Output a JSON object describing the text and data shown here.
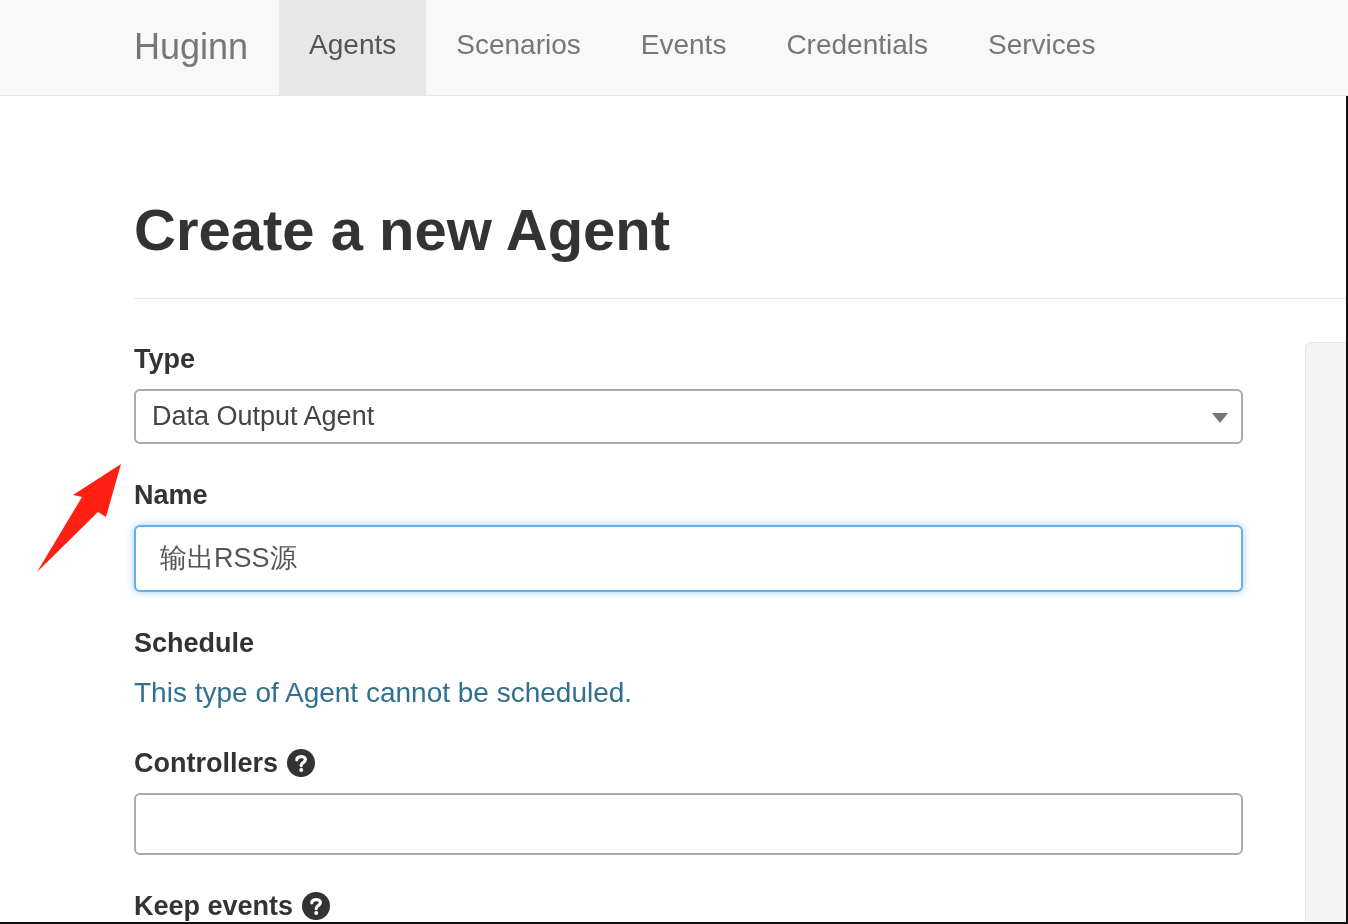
{
  "navbar": {
    "brand": "Huginn",
    "items": [
      {
        "label": "Agents",
        "selected": true
      },
      {
        "label": "Scenarios",
        "selected": false
      },
      {
        "label": "Events",
        "selected": false
      },
      {
        "label": "Credentials",
        "selected": false
      },
      {
        "label": "Services",
        "selected": false
      }
    ]
  },
  "page": {
    "title": "Create a new Agent"
  },
  "form": {
    "fields": [
      {
        "kind": "select",
        "label": "Type",
        "value": "Data Output Agent",
        "help": false
      },
      {
        "kind": "text",
        "label": "Name",
        "value": "输出RSS源",
        "focused": true,
        "help": false
      },
      {
        "kind": "note",
        "label": "Schedule",
        "note": "This type of Agent cannot be scheduled.",
        "help": false
      },
      {
        "kind": "text",
        "label": "Controllers",
        "focused": false,
        "help": true
      },
      {
        "kind": "label",
        "label": "Keep events",
        "help": true
      }
    ]
  }
}
